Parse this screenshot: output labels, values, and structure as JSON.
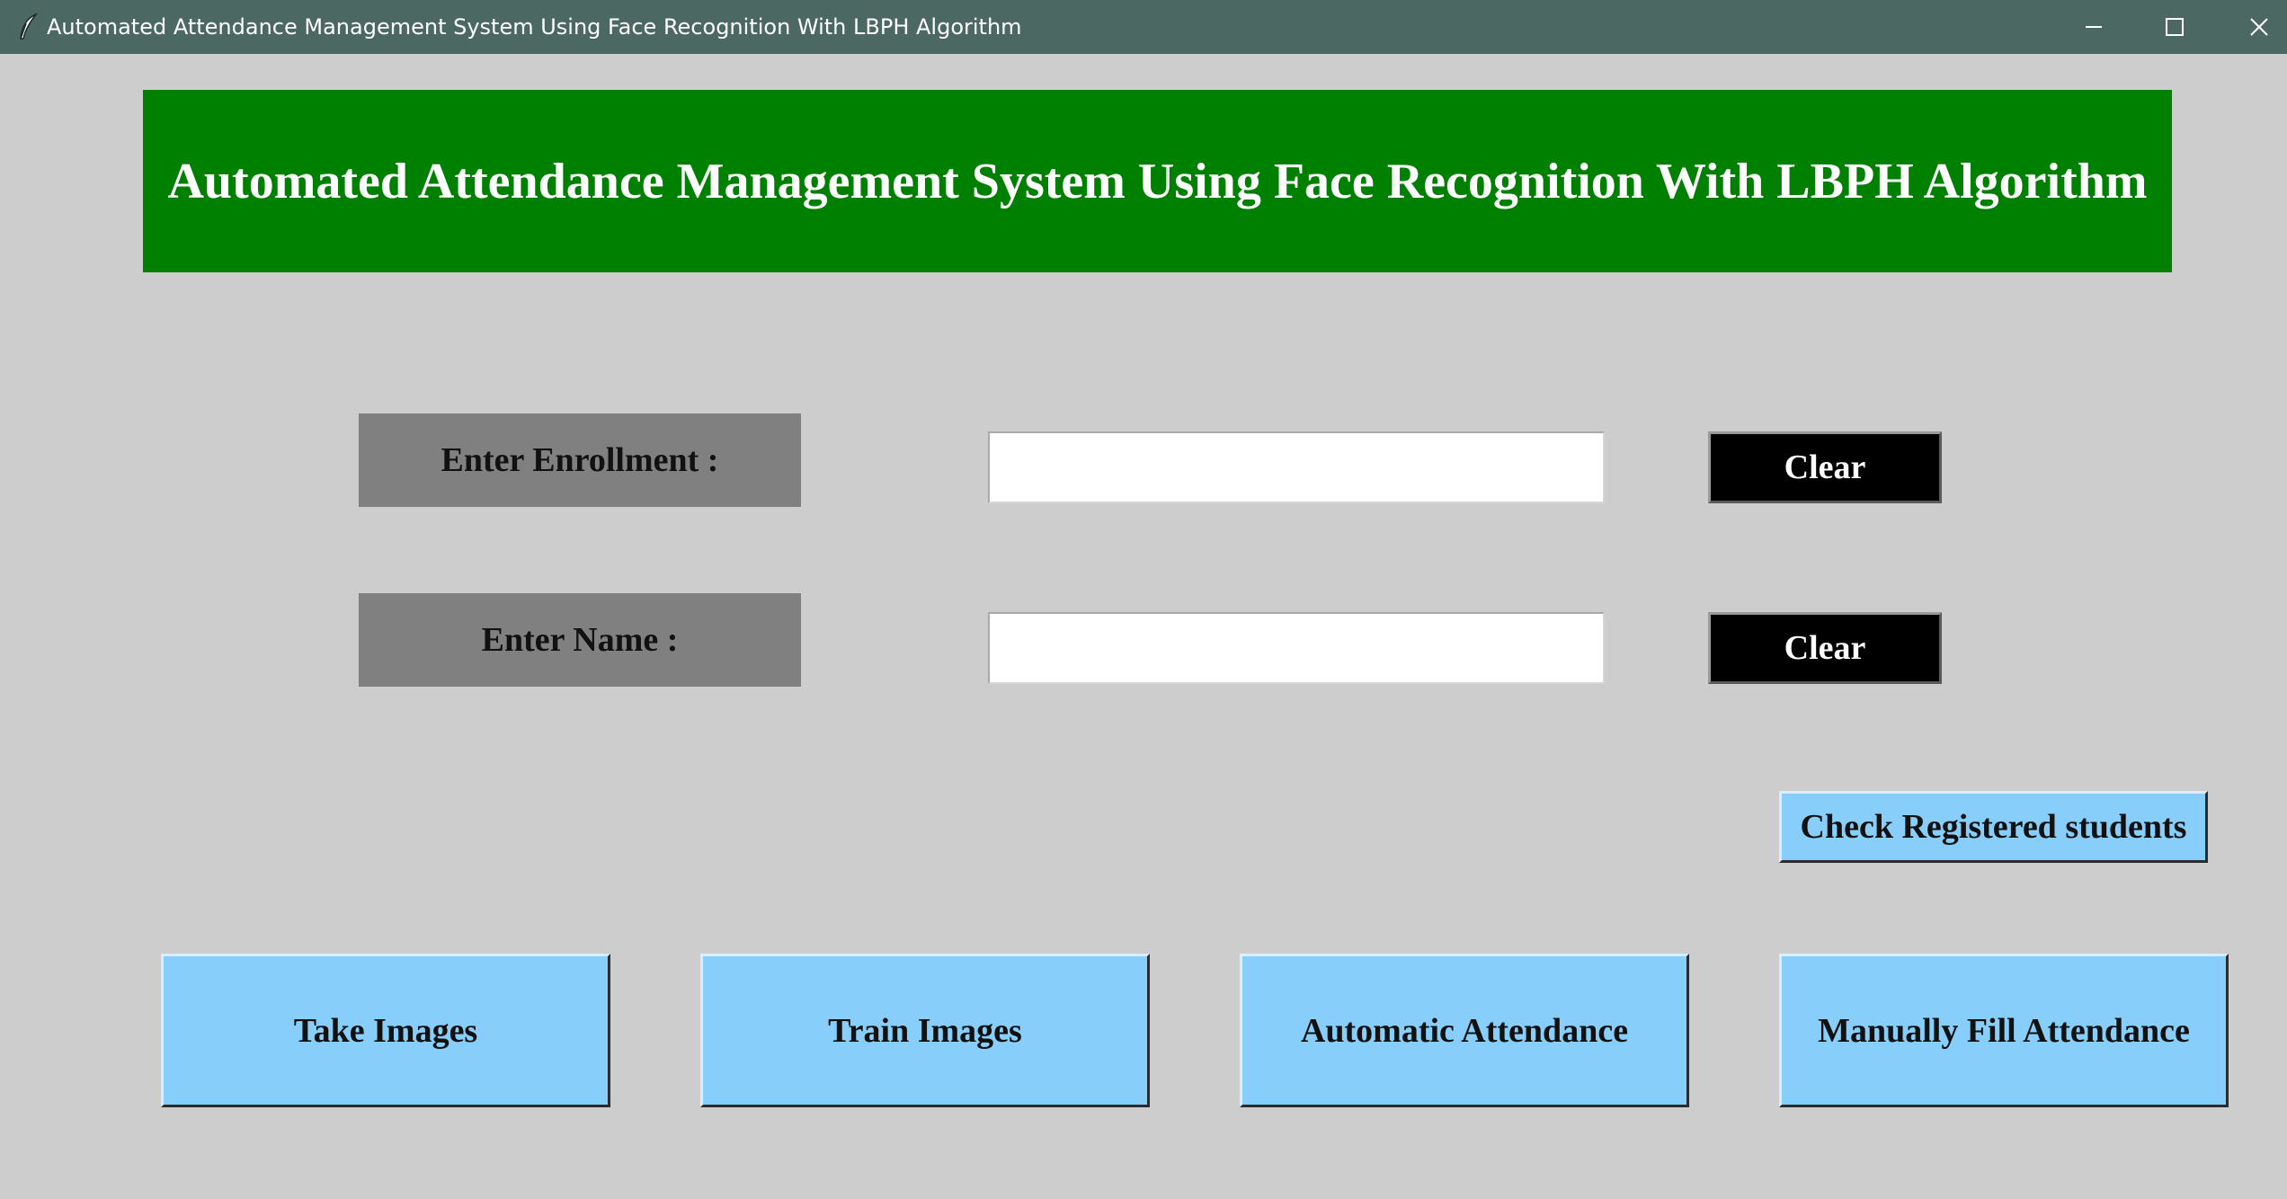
{
  "window": {
    "title": "Automated Attendance Management System Using Face Recognition With LBPH Algorithm",
    "app_icon": "feather-icon",
    "controls": [
      "minimize-icon",
      "maximize-icon",
      "close-icon"
    ]
  },
  "banner": {
    "text": "Automated Attendance Management System Using Face Recognition With LBPH Algorithm",
    "background_color": "#008000",
    "text_color": "#ffffff"
  },
  "form": {
    "enrollment": {
      "label": "Enter Enrollment :",
      "value": "",
      "clear_label": "Clear"
    },
    "name": {
      "label": "Enter Name :",
      "value": "",
      "clear_label": "Clear"
    }
  },
  "actions": {
    "check_registered": "Check Registered students",
    "take_images": "Take Images",
    "train_images": "Train Images",
    "automatic_attendance": "Automatic Attendance",
    "manual_attendance": "Manually Fill Attendance"
  },
  "colors": {
    "titlebar": "#4b6862",
    "window_background": "#cdcdcd",
    "label_background": "#808080",
    "clear_button": "#000000",
    "action_button": "#87cefa"
  }
}
